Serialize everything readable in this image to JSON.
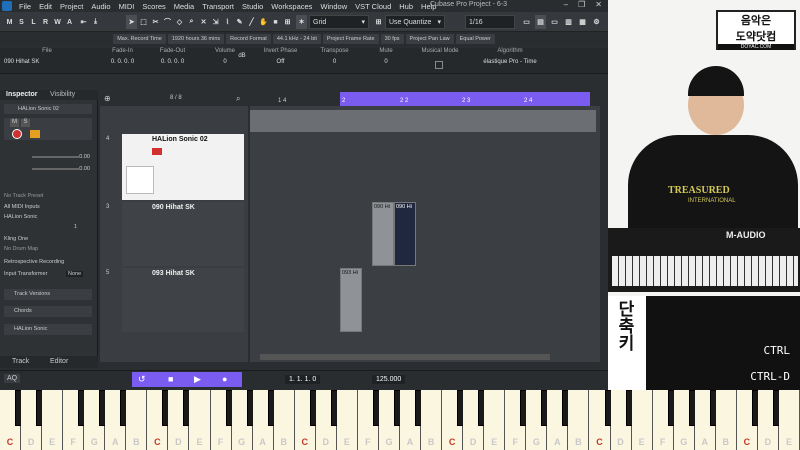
{
  "menu": {
    "items": [
      "File",
      "Edit",
      "Project",
      "Audio",
      "MIDI",
      "Scores",
      "Media",
      "Transport",
      "Studio",
      "Workspaces",
      "Window",
      "VST Cloud",
      "Hub",
      "Help"
    ],
    "window_title": "Cubase Pro Project - 6-3"
  },
  "toolbar": {
    "mode_letters": [
      "M",
      "S",
      "L",
      "R",
      "W",
      "A"
    ],
    "snap_type": "Grid",
    "quantize": "Use Quantize",
    "quantize_value": "1/16"
  },
  "statusbar": [
    "Max. Record Time",
    "1920 hours 36 mins",
    "Record Format",
    "44.1 kHz - 24 bit",
    "Project Frame Rate",
    "30 fps",
    "Project Pan Law",
    "Equal Power"
  ],
  "infoline": [
    {
      "h": "File",
      "v": "090 Hihat SK"
    },
    {
      "h": "Fade-In",
      "v": "0. 0. 0. 0"
    },
    {
      "h": "Fade-Out",
      "v": "0. 0. 0. 0"
    },
    {
      "h": "Volume",
      "v": "0"
    },
    {
      "h": "",
      "v": "dB"
    },
    {
      "h": "Invert Phase",
      "v": "Off"
    },
    {
      "h": "Transpose",
      "v": "0"
    },
    {
      "h": "Mute",
      "v": "0"
    },
    {
      "h": "Musical Mode",
      "v": ""
    },
    {
      "h": "Algorithm",
      "v": "élastique Pro - Time"
    }
  ],
  "inspector": {
    "tab1": "Inspector",
    "tab2": "Visibility",
    "track_name": "HALion Sonic 02",
    "vol": "0.00",
    "pan": "0.00",
    "preset": "No Track Preset",
    "input": "All MIDI Inputs",
    "output": "HALion Sonic",
    "channel": "1",
    "instrument": "Kling One",
    "drum_map": "No Drum Map",
    "retro": "Retrospective Recording",
    "transformer": "Input Transformer",
    "transformer_val": "None",
    "sec1": "Track Versions",
    "sec2": "Chords",
    "sec3": "HALion Sonic",
    "bottom_tab1": "Track",
    "bottom_tab2": "Editor"
  },
  "project": {
    "track_count": "8 / 8",
    "ruler": [
      "1 4",
      "2",
      "2 2",
      "2 3",
      "2 4"
    ],
    "tracks": [
      {
        "num": "4",
        "name": "HALion Sonic 02"
      },
      {
        "num": "3",
        "name": "090 Hihat SK"
      },
      {
        "num": "5",
        "name": "093 Hihat SK"
      }
    ],
    "clips": [
      "090 Hi",
      "090 Hi",
      "093 Hi"
    ]
  },
  "transport": {
    "position": "1. 1. 1.  0",
    "tempo": "125.000",
    "left_label": "AQ"
  },
  "video": {
    "logo_line1": "음악은",
    "logo_line2": "도약닷컴",
    "logo_url": "DOYAC.COM",
    "shirt_text": "TREASURED",
    "shirt_sub": "INTERNATIONAL",
    "keyboard_brand": "M-AUDIO",
    "shortcut_title": "단축키",
    "shortcut1": "CTRL",
    "shortcut2": "CTRL-D"
  },
  "piano_notes": [
    "C",
    "D",
    "E",
    "F",
    "G",
    "A",
    "B",
    "C",
    "D",
    "E",
    "F",
    "G",
    "A",
    "B",
    "C",
    "D",
    "E",
    "F",
    "G",
    "A",
    "B",
    "C",
    "D",
    "E",
    "F",
    "G",
    "A",
    "B",
    "C",
    "D",
    "E",
    "F",
    "G",
    "A",
    "B",
    "C",
    "D",
    "E"
  ],
  "colors": {
    "accent": "#7b5cf0",
    "record": "#d03030",
    "clip_selected": "#20283f"
  }
}
